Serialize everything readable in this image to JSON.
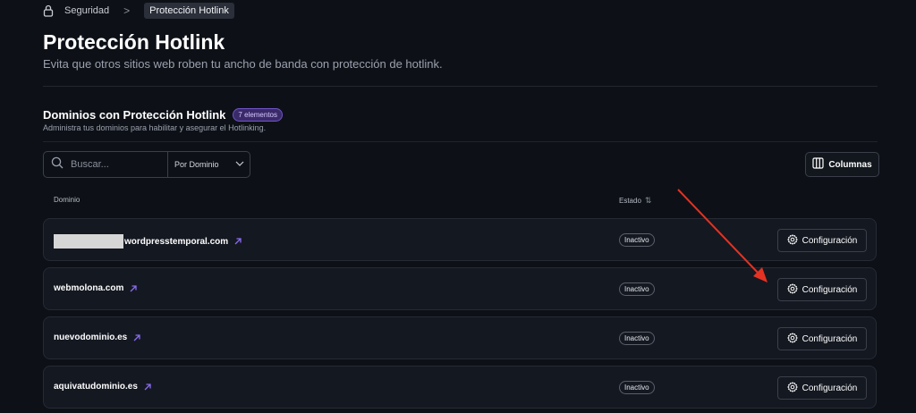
{
  "breadcrumb": {
    "parent": "Seguridad",
    "separator": ">",
    "current": "Protección Hotlink"
  },
  "page": {
    "title": "Protección Hotlink",
    "subtitle": "Evita que otros sitios web roben tu ancho de banda con protección de hotlink."
  },
  "section": {
    "title": "Dominios con Protección Hotlink",
    "count_badge": "7 elementos",
    "subtitle": "Administra tus dominios para habilitar y asegurar el Hotlinking."
  },
  "toolbar": {
    "search_placeholder": "Buscar...",
    "filter_label": "Por Dominio",
    "columns_label": "Columnas"
  },
  "table": {
    "headers": {
      "domain": "Dominio",
      "status": "Estado",
      "status_sort_icon": "⇅"
    },
    "rows": [
      {
        "domain": "wordpresstemporal.com",
        "status": "Inactivo",
        "action": "Configuración"
      },
      {
        "domain": "webmolona.com",
        "status": "Inactivo",
        "action": "Configuración"
      },
      {
        "domain": "nuevodominio.es",
        "status": "Inactivo",
        "action": "Configuración"
      },
      {
        "domain": "aquivatudominio.es",
        "status": "Inactivo",
        "action": "Configuración"
      }
    ]
  },
  "colors": {
    "background": "#0d1117",
    "row_background": "#141821",
    "accent_purple": "#8b6cf0",
    "annotation_arrow": "#e53222"
  },
  "icons": [
    "lock-icon",
    "chevron-right-icon",
    "search-icon",
    "chevron-down-icon",
    "columns-icon",
    "sort-icon",
    "external-link-icon",
    "gear-icon"
  ]
}
